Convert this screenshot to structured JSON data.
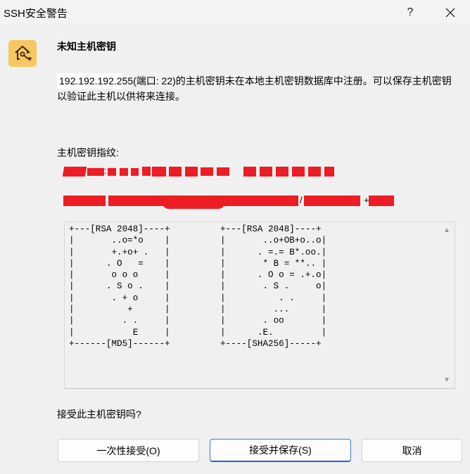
{
  "window": {
    "title": "SSH安全警告",
    "help_label": "?",
    "close_label": "✕"
  },
  "heading": "未知主机密钥",
  "message": {
    "ip": "192.192.192.2",
    "text": "55(端口: 22)的主机密钥未在本地主机密钥数据库中注册。可以保存主机密钥以验证此主机以供将来连接。"
  },
  "fingerprint": {
    "label": "主机密钥指纹:",
    "line1_visible": ":",
    "line2_visible": "/",
    "line2_suffix": "+"
  },
  "randomart": {
    "md5": "+---[RSA 2048]----+\n|       ..o=*o    |\n|       +.+o+ .   |\n|      . O   =    |\n|       o o o     |\n|      . S o .    |\n|       . + o     |\n|          +      |\n|         . .     |\n|           E     |\n+------[MD5]------+",
    "sha256": "+---[RSA 2048]----+\n|       ..o+OB+o..o|\n|      . =.= B*.oo.|\n|       * B = **.. |\n|      . O o = .+.o|\n|       . S .     o|\n|          . .     |\n|         ...      |\n|       . oo       |\n|      .E.         |\n+----[SHA256]-----+"
  },
  "question": "接受此主机密钥吗?",
  "buttons": {
    "once": "一次性接受(O)",
    "save": "接受并保存(S)",
    "cancel": "取消"
  },
  "colors": {
    "redaction": "#ee1c24",
    "key_icon_bg": "#f7c761",
    "primary_border": "#2066c4"
  },
  "icons": {
    "key_icon": "house-key-icon"
  }
}
